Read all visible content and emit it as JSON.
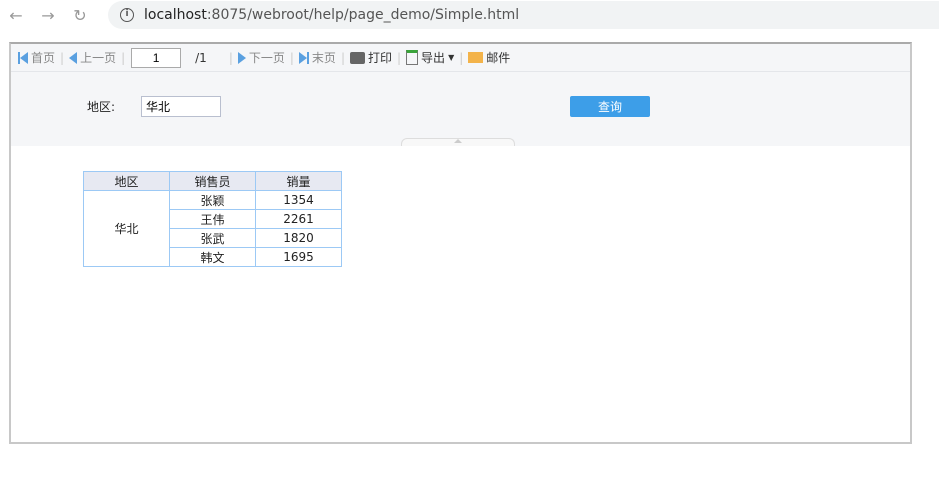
{
  "browser": {
    "url_host": "localhost",
    "url_rest": ":8075/webroot/help/page_demo/Simple.html"
  },
  "toolbar": {
    "first": "首页",
    "prev": "上一页",
    "page": "1",
    "total": "/1",
    "next": "下一页",
    "last": "末页",
    "print": "打印",
    "export": "导出",
    "mail": "邮件"
  },
  "params": {
    "region_label": "地区:",
    "region_value": "华北",
    "query": "查询"
  },
  "table": {
    "headers": [
      "地区",
      "销售员",
      "销量"
    ],
    "region": "华北",
    "rows": [
      [
        "张颖",
        "1354"
      ],
      [
        "王伟",
        "2261"
      ],
      [
        "张武",
        "1820"
      ],
      [
        "韩文",
        "1695"
      ]
    ]
  }
}
